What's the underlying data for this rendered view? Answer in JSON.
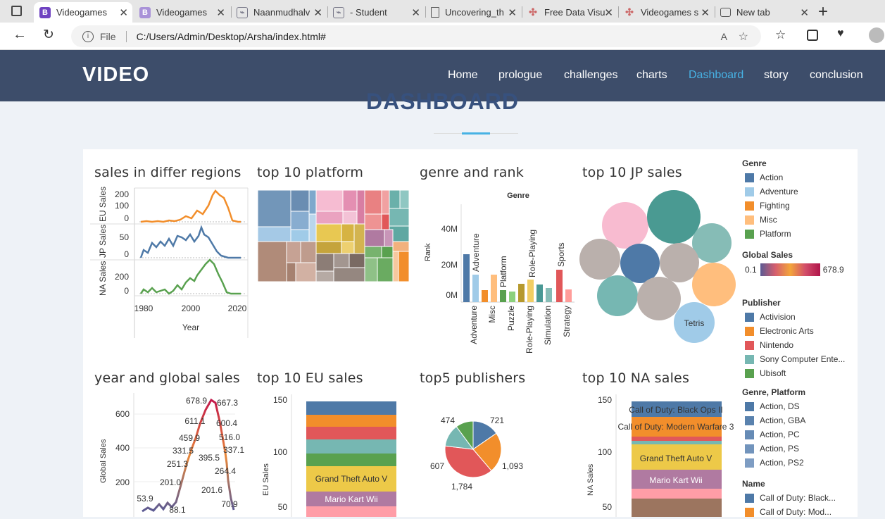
{
  "browser": {
    "tabs": [
      {
        "label": "Videogames",
        "icon": "B",
        "color": "#6f42c1",
        "active": true
      },
      {
        "label": "Videogames",
        "icon": "B",
        "color": "#a992d8"
      },
      {
        "label": "Naanmudhalv",
        "icon": "img"
      },
      {
        "label": "- Student",
        "icon": "img"
      },
      {
        "label": "Uncovering_th",
        "icon": "doc"
      },
      {
        "label": "Free Data Visu",
        "icon": "dots"
      },
      {
        "label": "Videogames s",
        "icon": "dots"
      },
      {
        "label": "New tab",
        "icon": "tab"
      }
    ],
    "file_label": "File",
    "url": "C:/Users/Admin/Desktop/Arsha/index.html#"
  },
  "site": {
    "logo": "VIDEO",
    "nav": [
      "Home",
      "prologue",
      "challenges",
      "charts",
      "Dashboard",
      "story",
      "conclusion"
    ],
    "active_nav": "Dashboard",
    "section_title": "DASHBOARD"
  },
  "viz": {
    "titles": [
      "sales in differ regions",
      "top 10 platform",
      "genre and rank",
      "top 10 JP sales",
      "year and global sales",
      "top 10 EU sales",
      "top5 publishers",
      "top 10 NA sales"
    ]
  },
  "legend": {
    "genre_title": "Genre",
    "genre": [
      {
        "name": "Action",
        "color": "#4e79a7"
      },
      {
        "name": "Adventure",
        "color": "#a0cbe8"
      },
      {
        "name": "Fighting",
        "color": "#f28e2b"
      },
      {
        "name": "Misc",
        "color": "#ffbe7d"
      },
      {
        "name": "Platform",
        "color": "#59a14f"
      }
    ],
    "gs_title": "Global Sales",
    "gs_min": "0.1",
    "gs_max": "678.9",
    "pub_title": "Publisher",
    "publisher": [
      {
        "name": "Activision",
        "color": "#4e79a7"
      },
      {
        "name": "Electronic Arts",
        "color": "#f28e2b"
      },
      {
        "name": "Nintendo",
        "color": "#e15759"
      },
      {
        "name": "Sony Computer Ente...",
        "color": "#76b7b2"
      },
      {
        "name": "Ubisoft",
        "color": "#59a14f"
      }
    ],
    "gp_title": "Genre, Platform",
    "gp": [
      {
        "name": "Action, DS",
        "color": "#4e79a7"
      },
      {
        "name": "Action, GBA",
        "color": "#5a82ae"
      },
      {
        "name": "Action, PC",
        "color": "#668bb5"
      },
      {
        "name": "Action, PS",
        "color": "#7294bc"
      },
      {
        "name": "Action, PS2",
        "color": "#7e9dc3"
      }
    ],
    "name_title": "Name",
    "names": [
      {
        "name": "Call of Duty: Black...",
        "color": "#4e79a7"
      },
      {
        "name": "Call of Duty: Mod...",
        "color": "#f28e2b"
      }
    ]
  },
  "regions": {
    "eu_label": "EU Sales",
    "jp_label": "JP Sales",
    "na_label": "NA Sales",
    "x_label": "Year",
    "eu_ticks": [
      "200",
      "100",
      "0"
    ],
    "jp_ticks": [
      "50",
      "0"
    ],
    "na_ticks": [
      "200",
      "0"
    ],
    "x_ticks": [
      "1980",
      "2000",
      "2020"
    ]
  },
  "genre_rank": {
    "header": "Genre",
    "y_label": "Rank",
    "ticks": [
      "40M",
      "20M",
      "0M"
    ],
    "bar_labels": [
      "Adventure",
      "Platform",
      "Role-Playing",
      "Sports"
    ],
    "x_labels": [
      "Adventure",
      "Misc",
      "Puzzle",
      "Role-Playing",
      "Simulation",
      "Strategy"
    ]
  },
  "jp_bubble": {
    "label": "Tetris"
  },
  "chart_data": [
    {
      "type": "line",
      "title": "year and global sales",
      "ylabel": "Global Sales",
      "y_ticks": [
        "600",
        "400",
        "200"
      ],
      "points": [
        {
          "label": "53.9",
          "value": 53.9
        },
        {
          "label": "201.0",
          "value": 201.0
        },
        {
          "label": "251.3",
          "value": 251.3
        },
        {
          "label": "331.5",
          "value": 331.5
        },
        {
          "label": "459.9",
          "value": 459.9
        },
        {
          "label": "611.1",
          "value": 611.1
        },
        {
          "label": "678.9",
          "value": 678.9
        },
        {
          "label": "667.3",
          "value": 667.3
        },
        {
          "label": "600.4",
          "value": 600.4
        },
        {
          "label": "516.0",
          "value": 516.0
        },
        {
          "label": "337.1",
          "value": 337.1
        },
        {
          "label": "395.5",
          "value": 395.5
        },
        {
          "label": "264.4",
          "value": 264.4
        },
        {
          "label": "201.6",
          "value": 201.6
        },
        {
          "label": "88.1",
          "value": 88.1
        },
        {
          "label": "70.9",
          "value": 70.9
        }
      ]
    },
    {
      "type": "bar",
      "title": "top 10 EU sales",
      "ylabel": "EU Sales",
      "y_ticks": [
        "150",
        "100",
        "50"
      ],
      "stack_labels": [
        "Grand Theft Auto V",
        "Mario Kart Wii"
      ]
    },
    {
      "type": "pie",
      "title": "top5 publishers",
      "slices": [
        {
          "label": "721",
          "value": 721,
          "color": "#4e79a7"
        },
        {
          "label": "1,093",
          "value": 1093,
          "color": "#f28e2b"
        },
        {
          "label": "1,784",
          "value": 1784,
          "color": "#e15759"
        },
        {
          "label": "607",
          "value": 607,
          "color": "#76b7b2"
        },
        {
          "label": "474",
          "value": 474,
          "color": "#59a14f"
        }
      ]
    },
    {
      "type": "bar",
      "title": "top 10 NA sales",
      "ylabel": "NA Sales",
      "y_ticks": [
        "150",
        "100",
        "50"
      ],
      "stack_labels": [
        "Call of Duty: Black Ops II",
        "Call of Duty: Modern Warfare 3",
        "Grand Theft Auto V",
        "Mario Kart Wii"
      ]
    }
  ]
}
